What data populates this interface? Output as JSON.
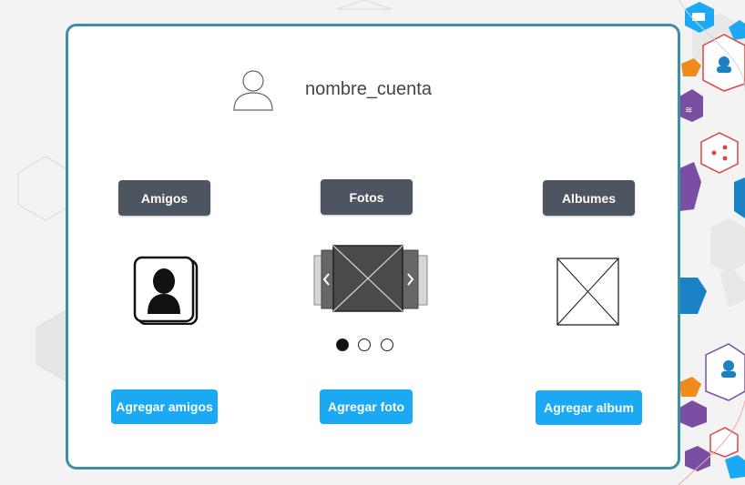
{
  "profile": {
    "avatar_icon": "user-icon",
    "username": "nombre_cuenta"
  },
  "tabs": [
    {
      "label": "Amigos"
    },
    {
      "label": "Fotos"
    },
    {
      "label": "Albumes"
    }
  ],
  "friends": {
    "icon": "contact-card-icon",
    "add_button": "Agregar amigos"
  },
  "photos": {
    "carousel_icon": "image-carousel-icon",
    "pages": 3,
    "active_page": 1,
    "add_button": "Agregar foto"
  },
  "albums": {
    "icon": "image-placeholder-icon",
    "add_button": "Agregar album"
  },
  "colors": {
    "card_border": "#3d8fa6",
    "tab_bg": "#4d5560",
    "action_bg": "#1aa9f2",
    "background": "#f3f3f3"
  }
}
